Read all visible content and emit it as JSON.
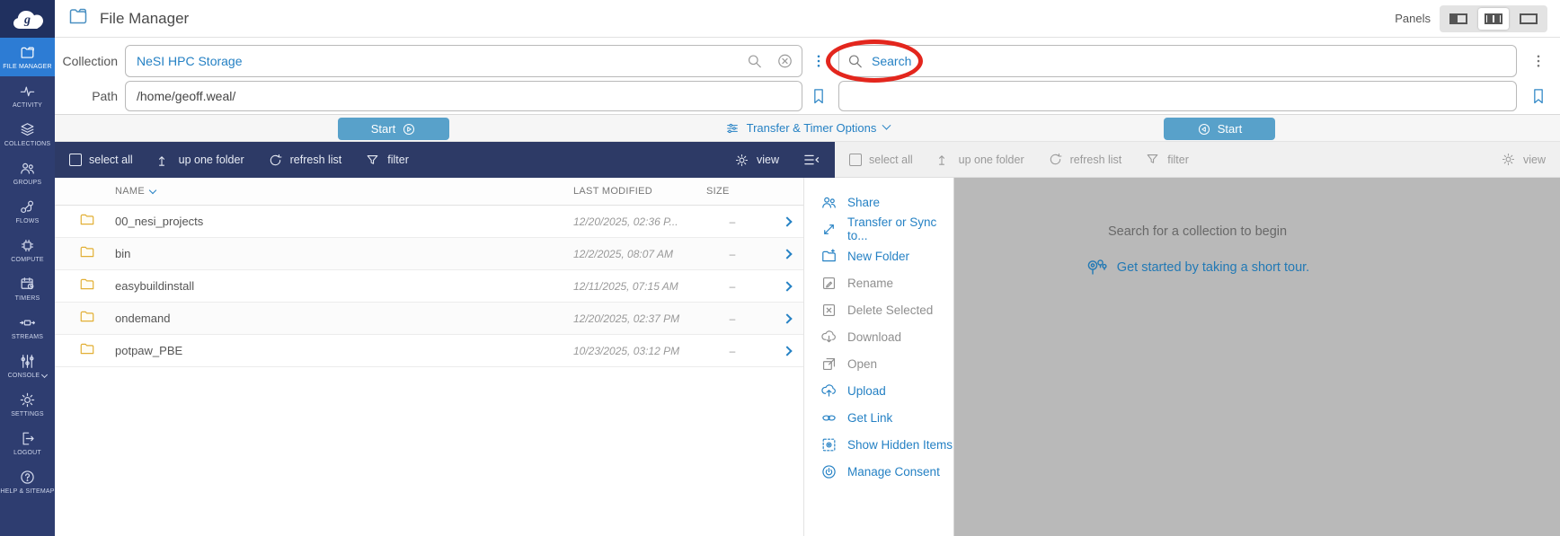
{
  "colors": {
    "sidebar_bg": "#2e3d70",
    "sidebar_active": "#2d7cd4",
    "toolbar_navy": "#2d3a66",
    "accent_blue": "#2581c4",
    "start_button_blue": "#58a1ca",
    "annotation_red": "#e3261d",
    "right_panel_gray": "#b9b9b9",
    "folder_yellow": "#e2af35"
  },
  "header": {
    "title": "File Manager",
    "panels_label": "Panels"
  },
  "sidebar": {
    "items": [
      {
        "label": "FILE MANAGER"
      },
      {
        "label": "ACTIVITY"
      },
      {
        "label": "COLLECTIONS"
      },
      {
        "label": "GROUPS"
      },
      {
        "label": "FLOWS"
      },
      {
        "label": "COMPUTE"
      },
      {
        "label": "TIMERS"
      },
      {
        "label": "STREAMS"
      },
      {
        "label": "CONSOLE"
      },
      {
        "label": "SETTINGS"
      },
      {
        "label": "LOGOUT"
      },
      {
        "label": "HELP & SITEMAP"
      }
    ]
  },
  "left_pane": {
    "collection_label": "Collection",
    "collection_value": "NeSI HPC Storage",
    "path_label": "Path",
    "path_value": "/home/geoff.weal/",
    "start_label": "Start",
    "toolbar": {
      "select_all": "select all",
      "up_one_folder": "up one folder",
      "refresh_list": "refresh list",
      "filter": "filter",
      "view": "view"
    },
    "table": {
      "col_name": "NAME",
      "col_modified": "LAST MODIFIED",
      "col_size": "SIZE",
      "rows": [
        {
          "name": "00_nesi_projects",
          "modified": "12/20/2025, 02:36 P...",
          "size": "–"
        },
        {
          "name": "bin",
          "modified": "12/2/2025, 08:07 AM",
          "size": "–"
        },
        {
          "name": "easybuildinstall",
          "modified": "12/11/2025, 07:15 AM",
          "size": "–"
        },
        {
          "name": "ondemand",
          "modified": "12/20/2025, 02:37 PM",
          "size": "–"
        },
        {
          "name": "potpaw_PBE",
          "modified": "10/23/2025, 03:12 PM",
          "size": "–"
        }
      ]
    }
  },
  "options_bar": {
    "label": "Transfer & Timer Options"
  },
  "right_pane": {
    "search_placeholder": "Search",
    "start_label": "Start",
    "toolbar": {
      "select_all": "select all",
      "up_one_folder": "up one folder",
      "refresh_list": "refresh list",
      "filter": "filter",
      "view": "view"
    },
    "empty_text": "Search for a collection to begin",
    "tour_text": "Get started by taking a short tour."
  },
  "action_menu": {
    "items": [
      {
        "label": "Share"
      },
      {
        "label": "Transfer or Sync to..."
      },
      {
        "label": "New Folder"
      },
      {
        "label": "Rename"
      },
      {
        "label": "Delete Selected"
      },
      {
        "label": "Download"
      },
      {
        "label": "Open"
      },
      {
        "label": "Upload"
      },
      {
        "label": "Get Link"
      },
      {
        "label": "Show Hidden Items"
      },
      {
        "label": "Manage Consent"
      }
    ]
  }
}
